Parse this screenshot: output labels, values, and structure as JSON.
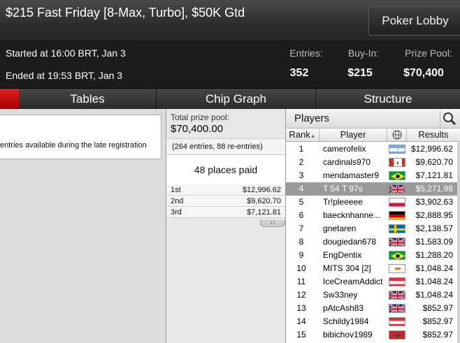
{
  "header": {
    "title": "$215 Fast Friday [8-Max, Turbo], $50K Gtd",
    "lobby_button": "Poker Lobby"
  },
  "info": {
    "started": "Started at 16:00 BRT, Jan 3",
    "ended": "Ended at 19:53 BRT, Jan 3",
    "entries_label": "Entries:",
    "entries_value": "352",
    "buyin_label": "Buy-In:",
    "buyin_value": "$215",
    "prizepool_label": "Prize Pool:",
    "prizepool_value": "$70,400"
  },
  "tabs": [
    "Tables",
    "Chip Graph",
    "Structure"
  ],
  "notice": "entries available during the late registration",
  "prize": {
    "label": "Total prize pool:",
    "value": "$70,400.00",
    "entries_note": "(264 entries, 88 re-entries)",
    "places_paid": "48 places paid",
    "payouts": [
      {
        "place": "1st",
        "amount": "$12,996.62"
      },
      {
        "place": "2nd",
        "amount": "$9,620.70"
      },
      {
        "place": "3rd",
        "amount": "$7,121.81"
      }
    ]
  },
  "players": {
    "title": "Players",
    "columns": {
      "rank": "Rank",
      "player": "Player",
      "results": "Results"
    },
    "rows": [
      {
        "rank": "1",
        "name": "camerofelix",
        "flag": "argentina-flag",
        "result": "$12,996.62"
      },
      {
        "rank": "2",
        "name": "cardinals970",
        "flag": "canada-flag",
        "result": "$9,620.70"
      },
      {
        "rank": "3",
        "name": "mendamaster9",
        "flag": "brazil-flag",
        "result": "$7,121.81"
      },
      {
        "rank": "4",
        "name": "T 54 T 97s",
        "flag": "uk-flag",
        "result": "$5,271.98"
      },
      {
        "rank": "5",
        "name": "Tr!pleeeee",
        "flag": "poland-flag",
        "result": "$3,902.63"
      },
      {
        "rank": "6",
        "name": "baecknhanne...",
        "flag": "germany-flag",
        "result": "$2,888.95"
      },
      {
        "rank": "7",
        "name": "gnetaren",
        "flag": "sweden-flag",
        "result": "$2,138.57"
      },
      {
        "rank": "8",
        "name": "dougiedan678",
        "flag": "uk-flag",
        "result": "$1,583.09"
      },
      {
        "rank": "9",
        "name": "EngDentix",
        "flag": "brazil-flag",
        "result": "$1,288.20"
      },
      {
        "rank": "10",
        "name": "MITS 304 [2]",
        "flag": "cyprus-flag",
        "result": "$1,048.24"
      },
      {
        "rank": "11",
        "name": "IceCreamAddict",
        "flag": "austria-flag",
        "result": "$1,048.24"
      },
      {
        "rank": "12",
        "name": "Sw33ney",
        "flag": "uk-flag",
        "result": "$1,048.24"
      },
      {
        "rank": "13",
        "name": "pAtcAsh83",
        "flag": "uk-flag",
        "result": "$852.97"
      },
      {
        "rank": "14",
        "name": "Schildy1984",
        "flag": "austria-flag",
        "result": "$852.97"
      },
      {
        "rank": "15",
        "name": "bibichov1989",
        "flag": "morocco-flag",
        "result": "$852.97"
      }
    ],
    "selected_rank": "4"
  },
  "icons": {
    "search": "search-icon",
    "globe": "globe-icon",
    "sort": "sort-up-icon",
    "expand": "chevron-double-down-icon"
  }
}
